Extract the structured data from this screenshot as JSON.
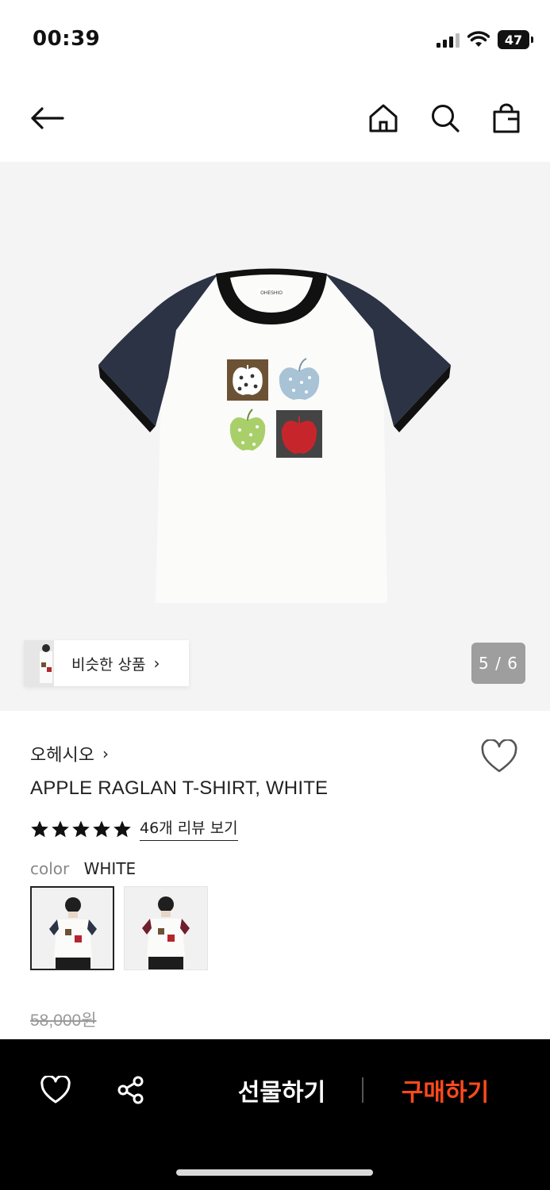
{
  "status_bar": {
    "time": "00:39",
    "battery": "47"
  },
  "nav": {
    "back_icon": "arrow-left-icon",
    "home_icon": "home-icon",
    "search_icon": "search-icon",
    "bag_icon": "shopping-bag-icon"
  },
  "gallery": {
    "similar_label": "비슷한 상품",
    "page_indicator": "5 / 6",
    "print_tag": "OHESHIO"
  },
  "product": {
    "brand": "오헤시오",
    "title": "APPLE RAGLAN T-SHIRT, WHITE",
    "rating_stars": 5,
    "review_link": "46개 리뷰 보기",
    "color_label": "color",
    "color_value": "WHITE",
    "swatches": [
      {
        "name": "white-navy",
        "selected": true,
        "sleeve_color": "#2c3446"
      },
      {
        "name": "white-burgundy",
        "selected": false,
        "sleeve_color": "#6e1f2b"
      }
    ],
    "original_price": "58,000원"
  },
  "bottom_bar": {
    "gift_label": "선물하기",
    "buy_label": "구매하기",
    "buy_color": "#ff4a1c"
  }
}
